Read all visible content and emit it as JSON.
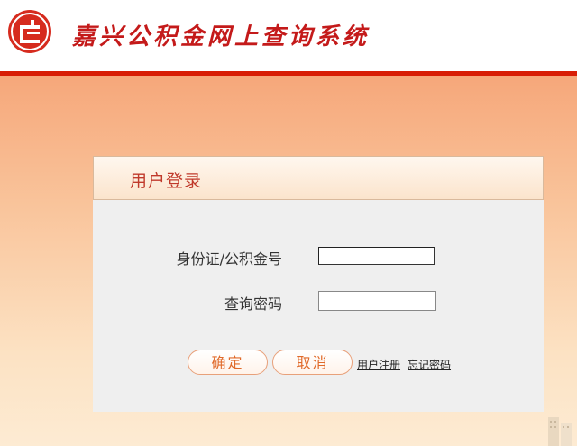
{
  "header": {
    "title": "嘉兴公积金网上查询系统",
    "logo_icon": "housing-fund-logo-icon",
    "accent_color": "#c41a1a",
    "rule_color": "#d81e06"
  },
  "login": {
    "title": "用户登录",
    "id_label": "身份证/公积金号",
    "id_value": "",
    "password_label": "查询密码",
    "password_value": "",
    "confirm_label": "确定",
    "cancel_label": "取消",
    "register_link": "用户注册",
    "forgot_link": "忘记密码"
  }
}
